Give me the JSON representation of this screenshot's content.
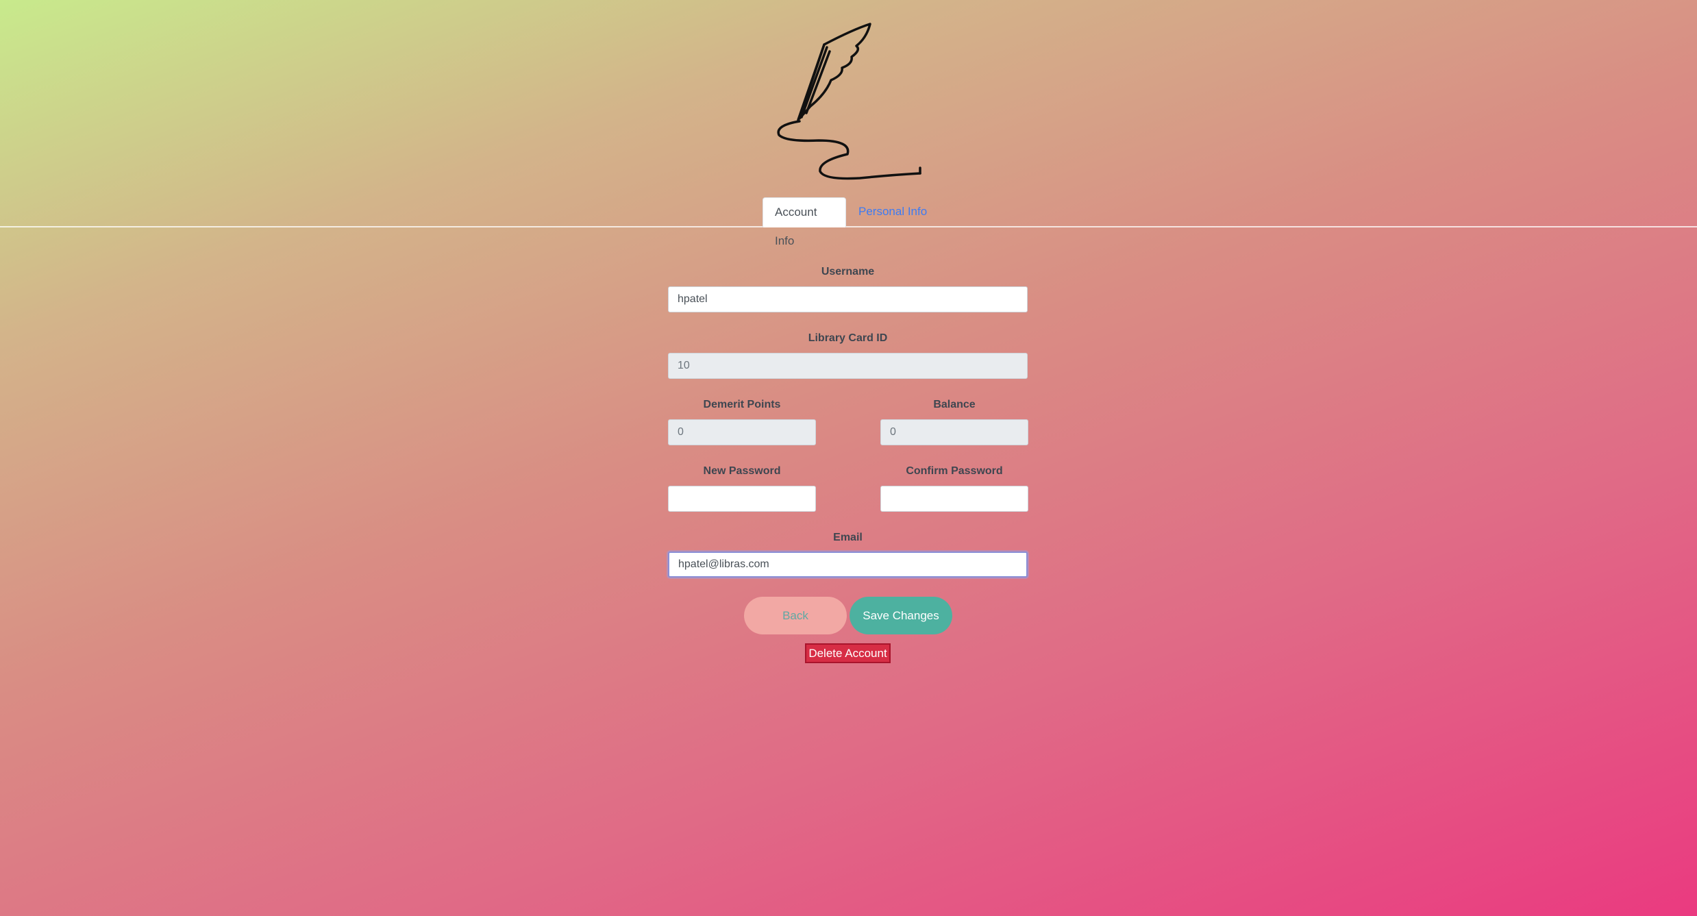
{
  "tabs": {
    "account_info": "Account Info",
    "personal_info": "Personal Info"
  },
  "form": {
    "username_label": "Username",
    "username_value": "hpatel",
    "library_card_label": "Library Card ID",
    "library_card_value": "10",
    "demerit_label": "Demerit Points",
    "demerit_value": "0",
    "balance_label": "Balance",
    "balance_value": "0",
    "new_password_label": "New Password",
    "new_password_value": "",
    "confirm_password_label": "Confirm Password",
    "confirm_password_value": "",
    "email_label": "Email",
    "email_value": "hpatel@libras.com"
  },
  "buttons": {
    "back": "Back",
    "save": "Save Changes",
    "delete": "Delete Account"
  },
  "colors": {
    "save_button": "#4db1a0",
    "back_button": "#f2a8a4",
    "delete_button": "#d72d45",
    "active_tab_text": "#495057",
    "link_tab_text": "#3d7bf2"
  },
  "icons": {
    "logo": "quill-pen-icon"
  }
}
